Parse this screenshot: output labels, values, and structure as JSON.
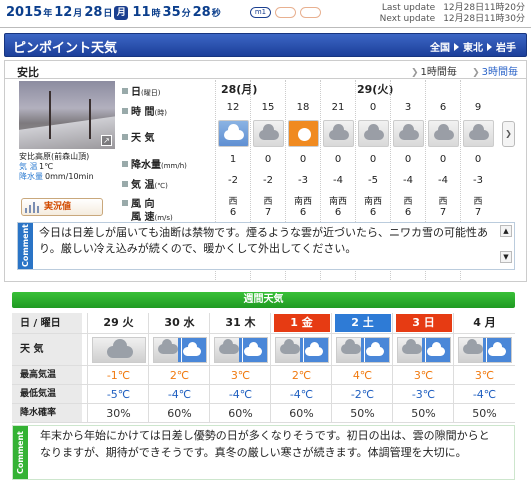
{
  "datebar": {
    "year": "2015",
    "u_year": "年",
    "month": "12",
    "u_month": "月",
    "day": "28",
    "u_day": "日",
    "weekday": "月",
    "hour": "11",
    "u_hour": "時",
    "minute": "35",
    "u_minute": "分",
    "second": "28",
    "u_second": "秒",
    "pill_m1": "m1",
    "pill_2": "",
    "pill_3": "",
    "last_update_label": "Last update",
    "last_update_value": "12月28日11時20分",
    "next_update_label": "Next update",
    "next_update_value": "12月28日11時30分"
  },
  "titlebar": {
    "title": "ピンポイント天気",
    "crumbs": [
      "全国",
      "東北",
      "岩手"
    ]
  },
  "location": {
    "name": "安比",
    "tab_1h": "1時間毎",
    "tab_3h": "3時間毎"
  },
  "camera": {
    "name": "安比高原(前森山頂)",
    "temp_label": "気 温",
    "temp_value": "1℃",
    "precip_label": "降水量",
    "precip_value": "0mm/10min",
    "live_button": "実況値"
  },
  "row_labels": {
    "date": "日",
    "date_unit": "(曜日)",
    "time": "時 間",
    "time_unit": "(時)",
    "weather": "天 気",
    "precip": "降水量",
    "precip_unit": "(mm/h)",
    "temp": "気 温",
    "temp_unit": "(℃)",
    "wind": "風 向",
    "wind2": "風 速",
    "wind_unit": "(m/s)"
  },
  "days": [
    {
      "label": "28(月)"
    },
    {
      "label": "29(火)"
    }
  ],
  "hourly": [
    {
      "time": "12",
      "weather": "snow-icon",
      "precip": "1",
      "temp": "-2",
      "wdir": "西",
      "wspd": "6"
    },
    {
      "time": "15",
      "weather": "cloud-icon",
      "precip": "0",
      "temp": "-2",
      "wdir": "西",
      "wspd": "7"
    },
    {
      "time": "18",
      "weather": "sun-icon",
      "precip": "0",
      "temp": "-3",
      "wdir": "南西",
      "wspd": "6"
    },
    {
      "time": "21",
      "weather": "cloud-icon",
      "precip": "0",
      "temp": "-4",
      "wdir": "南西",
      "wspd": "6"
    },
    {
      "time": "0",
      "weather": "cloud-icon",
      "precip": "0",
      "temp": "-5",
      "wdir": "南西",
      "wspd": "6"
    },
    {
      "time": "3",
      "weather": "cloud-icon",
      "precip": "0",
      "temp": "-4",
      "wdir": "西",
      "wspd": "6"
    },
    {
      "time": "6",
      "weather": "cloud-icon",
      "precip": "0",
      "temp": "-4",
      "wdir": "西",
      "wspd": "7"
    },
    {
      "time": "9",
      "weather": "cloud-icon",
      "precip": "0",
      "temp": "-3",
      "wdir": "西",
      "wspd": "7"
    }
  ],
  "comment": {
    "tag": "Comment",
    "text": "今日は日差しが届いても油断は禁物です。煙るような雲が近づいたら、ニワカ雪の可能性あり。厳しい冷え込みが続くので、暖かくして外出してください。"
  },
  "weekly": {
    "title": "週間天気",
    "labels": {
      "date": "日 / 曜日",
      "weather": "天 気",
      "max": "最高気温",
      "min": "最低気温",
      "pop": "降水確率"
    },
    "days": [
      {
        "date": "29 火",
        "style": "normal",
        "weather": "cloud-icon",
        "max": "-1℃",
        "min": "-5℃",
        "pop": "30%"
      },
      {
        "date": "30 水",
        "style": "normal",
        "weather": "cloud-snow-icon",
        "max": "2℃",
        "min": "-4℃",
        "pop": "60%"
      },
      {
        "date": "31 木",
        "style": "normal",
        "weather": "cloud-snow-icon",
        "max": "3℃",
        "min": "-4℃",
        "pop": "60%"
      },
      {
        "date": "1 金",
        "style": "red",
        "weather": "cloud-snow-icon",
        "max": "2℃",
        "min": "-4℃",
        "pop": "60%"
      },
      {
        "date": "2 土",
        "style": "blue",
        "weather": "cloud-snow-icon",
        "max": "4℃",
        "min": "-2℃",
        "pop": "50%"
      },
      {
        "date": "3 日",
        "style": "red",
        "weather": "cloud-snow-icon",
        "max": "3℃",
        "min": "-3℃",
        "pop": "50%"
      },
      {
        "date": "4 月",
        "style": "normal",
        "weather": "cloud-snow-icon",
        "max": "3℃",
        "min": "-4℃",
        "pop": "50%"
      }
    ],
    "comment_tag": "Comment",
    "comment": "年末から年始にかけては日差し優勢の日が多くなりそうです。初日の出は、雲の隙間からとなりますが、期待ができそうです。真冬の厳しい寒さが続きます。体調管理を大切に。"
  }
}
